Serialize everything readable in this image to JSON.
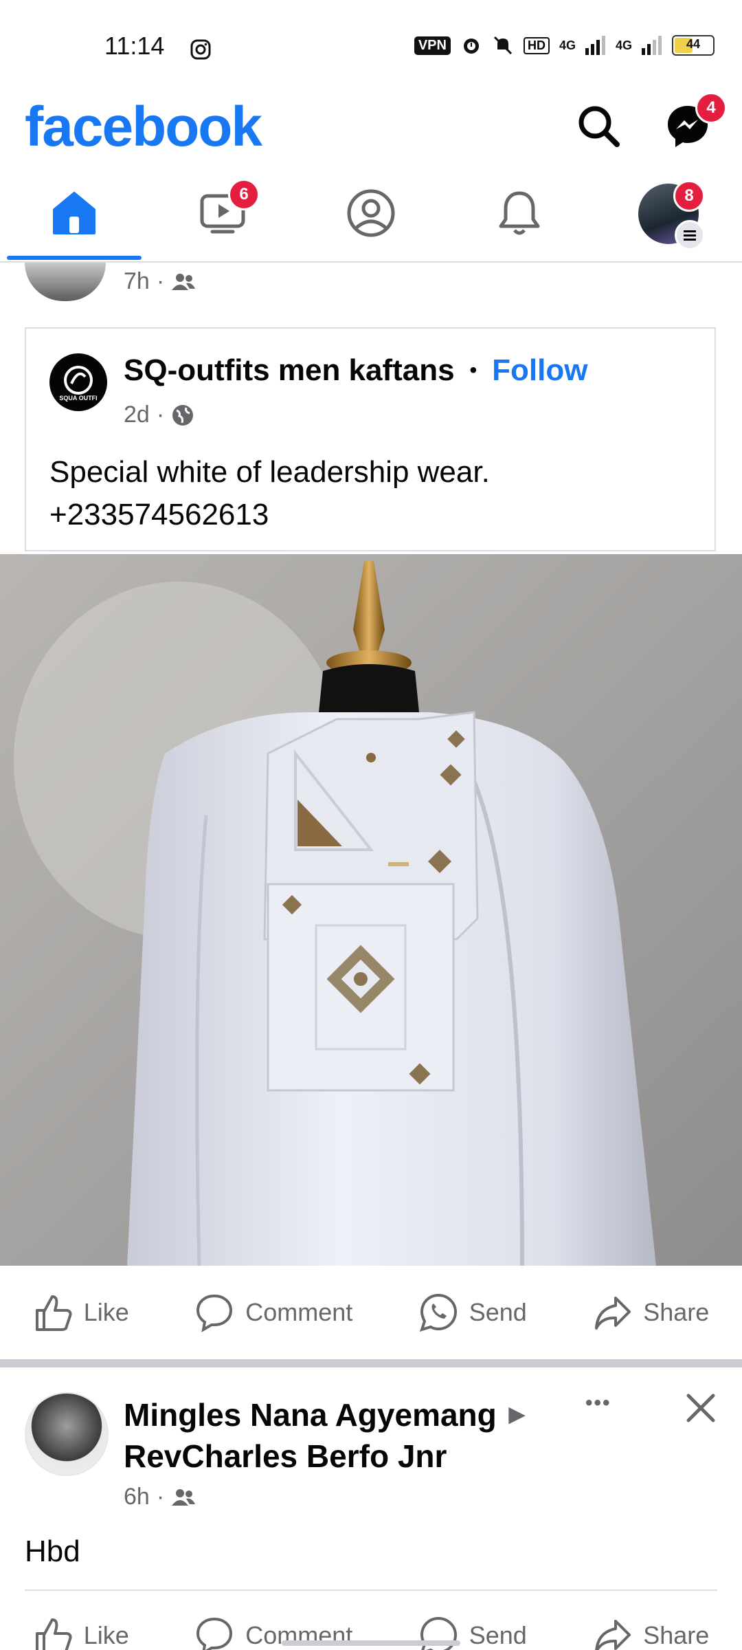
{
  "status_bar": {
    "time": "11:14",
    "vpn": "VPN",
    "hd": "HD",
    "net1": "4G",
    "net2": "4G",
    "battery": "44"
  },
  "header": {
    "logo": "facebook",
    "messenger_badge": "4"
  },
  "tabs": {
    "watch_badge": "6",
    "menu_badge": "8"
  },
  "prev_post": {
    "time": "7h"
  },
  "shared_post": {
    "page_name": "SQ-outfits men kaftans",
    "dot": "•",
    "follow": "Follow",
    "time": "2d",
    "text_line1": "Special white of leadership wear.",
    "text_line2": "+233574562613",
    "logo_text": "SQUA OUTFI"
  },
  "actions": {
    "like": "Like",
    "comment": "Comment",
    "send": "Send",
    "share": "Share"
  },
  "next_post": {
    "author": "Mingles Nana Agyemang",
    "arrow": "▶",
    "recipient": "RevCharles Berfo Jnr",
    "time": "6h",
    "text": "Hbd",
    "more": "•••"
  },
  "colors": {
    "brand": "#1877f2",
    "badge": "#e41e3f",
    "secondary_text": "#65676b"
  }
}
